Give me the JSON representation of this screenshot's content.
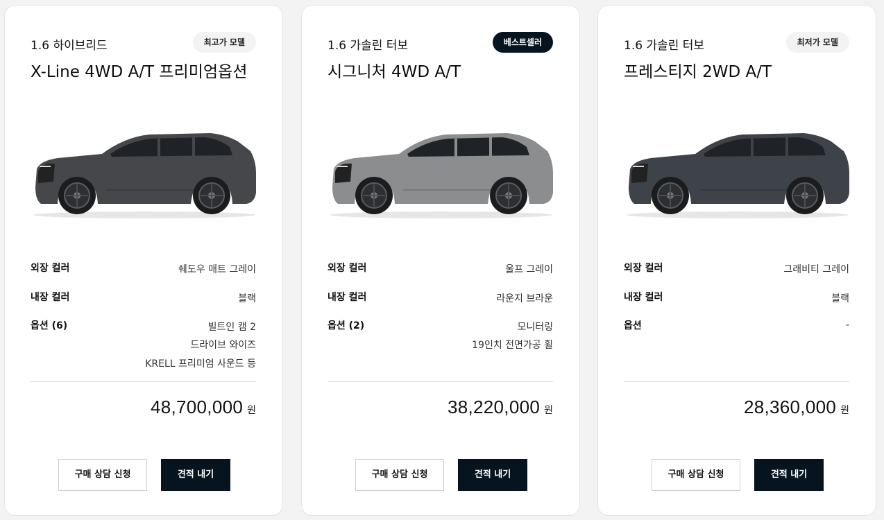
{
  "cards": [
    {
      "trim": "1.6 하이브리드",
      "badge": "최고가 모델",
      "model": "X-Line 4WD A/T 프리미엄옵션",
      "exterior_label": "외장 컬러",
      "exterior_value": "쉐도우 매트 그레이",
      "interior_label": "내장 컬러",
      "interior_value": "블랙",
      "options_label": "옵션 (6)",
      "options": [
        "빌트인 캠 2",
        "드라이브 와이즈",
        "KRELL 프리미엄 사운드 등"
      ],
      "price": "48,700,000",
      "price_unit": "원",
      "consult_label": "구매 상담 신청",
      "quote_label": "견적 내기",
      "car_color": "#45474a",
      "badge_style": "light"
    },
    {
      "trim": "1.6 가솔린 터보",
      "badge": "베스트셀러",
      "model": "시그니처 4WD A/T",
      "exterior_label": "외장 컬러",
      "exterior_value": "울프 그레이",
      "interior_label": "내장 컬러",
      "interior_value": "라운지 브라운",
      "options_label": "옵션 (2)",
      "options": [
        "모니터링",
        "19인치 전면가공 휠"
      ],
      "price": "38,220,000",
      "price_unit": "원",
      "consult_label": "구매 상담 신청",
      "quote_label": "견적 내기",
      "car_color": "#8c8d8f",
      "badge_style": "dark"
    },
    {
      "trim": "1.6 가솔린 터보",
      "badge": "최저가 모델",
      "model": "프레스티지 2WD A/T",
      "exterior_label": "외장 컬러",
      "exterior_value": "그래비티 그레이",
      "interior_label": "내장 컬러",
      "interior_value": "블랙",
      "options_label": "옵션",
      "options": [
        "-"
      ],
      "price": "28,360,000",
      "price_unit": "원",
      "consult_label": "구매 상담 신청",
      "quote_label": "견적 내기",
      "car_color": "#3e4349",
      "badge_style": "light"
    }
  ]
}
